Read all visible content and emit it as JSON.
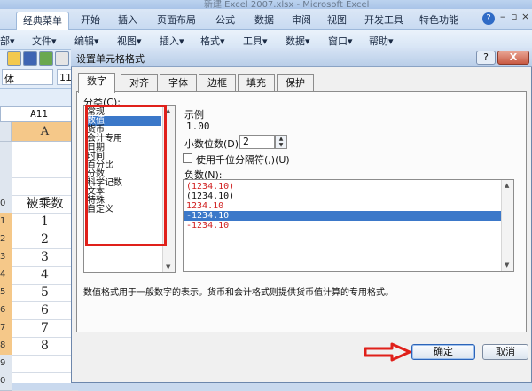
{
  "excel": {
    "title_fragment": "新建 Excel 2007.xlsx - Microsoft Excel",
    "ribbon_tabs": [
      "经典菜单",
      "开始",
      "插入",
      "页面布局",
      "公式",
      "数据",
      "审阅",
      "视图",
      "开发工具",
      "特色功能"
    ],
    "active_tab": "经典菜单",
    "menu_items": [
      "部▾",
      "文件▾",
      "编辑▾",
      "视图▾",
      "插入▾",
      "格式▾",
      "工具▾",
      "数据▾",
      "窗口▾",
      "帮助▾"
    ],
    "font_name": "体",
    "font_size": "11",
    "name_box": "A11",
    "column_header": "A",
    "row_labels": [
      "",
      "",
      "",
      "0",
      "1",
      "2",
      "3",
      "4",
      "5",
      "6",
      "7",
      "8",
      "9",
      "0"
    ],
    "cells": [
      "",
      "",
      "",
      "被乘数",
      "1",
      "2",
      "3",
      "4",
      "5",
      "6",
      "7",
      "8",
      "",
      ""
    ]
  },
  "dialog": {
    "title": "设置单元格格式",
    "help_label": "?",
    "close_label": "X",
    "tabs": [
      "数字",
      "对齐",
      "字体",
      "边框",
      "填充",
      "保护"
    ],
    "active_tab": "数字",
    "category_label": "分类(C):",
    "categories": [
      "常规",
      "数值",
      "货币",
      "会计专用",
      "日期",
      "时间",
      "百分比",
      "分数",
      "科学记数",
      "文本",
      "特殊",
      "自定义"
    ],
    "selected_category": "数值",
    "sample_label": "示例",
    "sample_value": "1.00",
    "decimal_label": "小数位数(D):",
    "decimal_value": "2",
    "thousands_label": "使用千位分隔符(,)(U)",
    "thousands_checked": false,
    "negative_label": "负数(N):",
    "negative_options": [
      "(1234.10)",
      "(1234.10)",
      "1234.10",
      "-1234.10",
      "-1234.10"
    ],
    "negative_colors": [
      "#d02020",
      "#111111",
      "#d02020",
      "#ffffff",
      "#d02020"
    ],
    "selected_negative_index": 3,
    "description": "数值格式用于一般数字的表示。货币和会计格式则提供货币值计算的专用格式。",
    "ok_label": "确定",
    "cancel_label": "取消"
  },
  "colors": {
    "annotation_red": "#e0201a",
    "selection_blue": "#3b78c9",
    "header_orange": "#f5c889"
  }
}
